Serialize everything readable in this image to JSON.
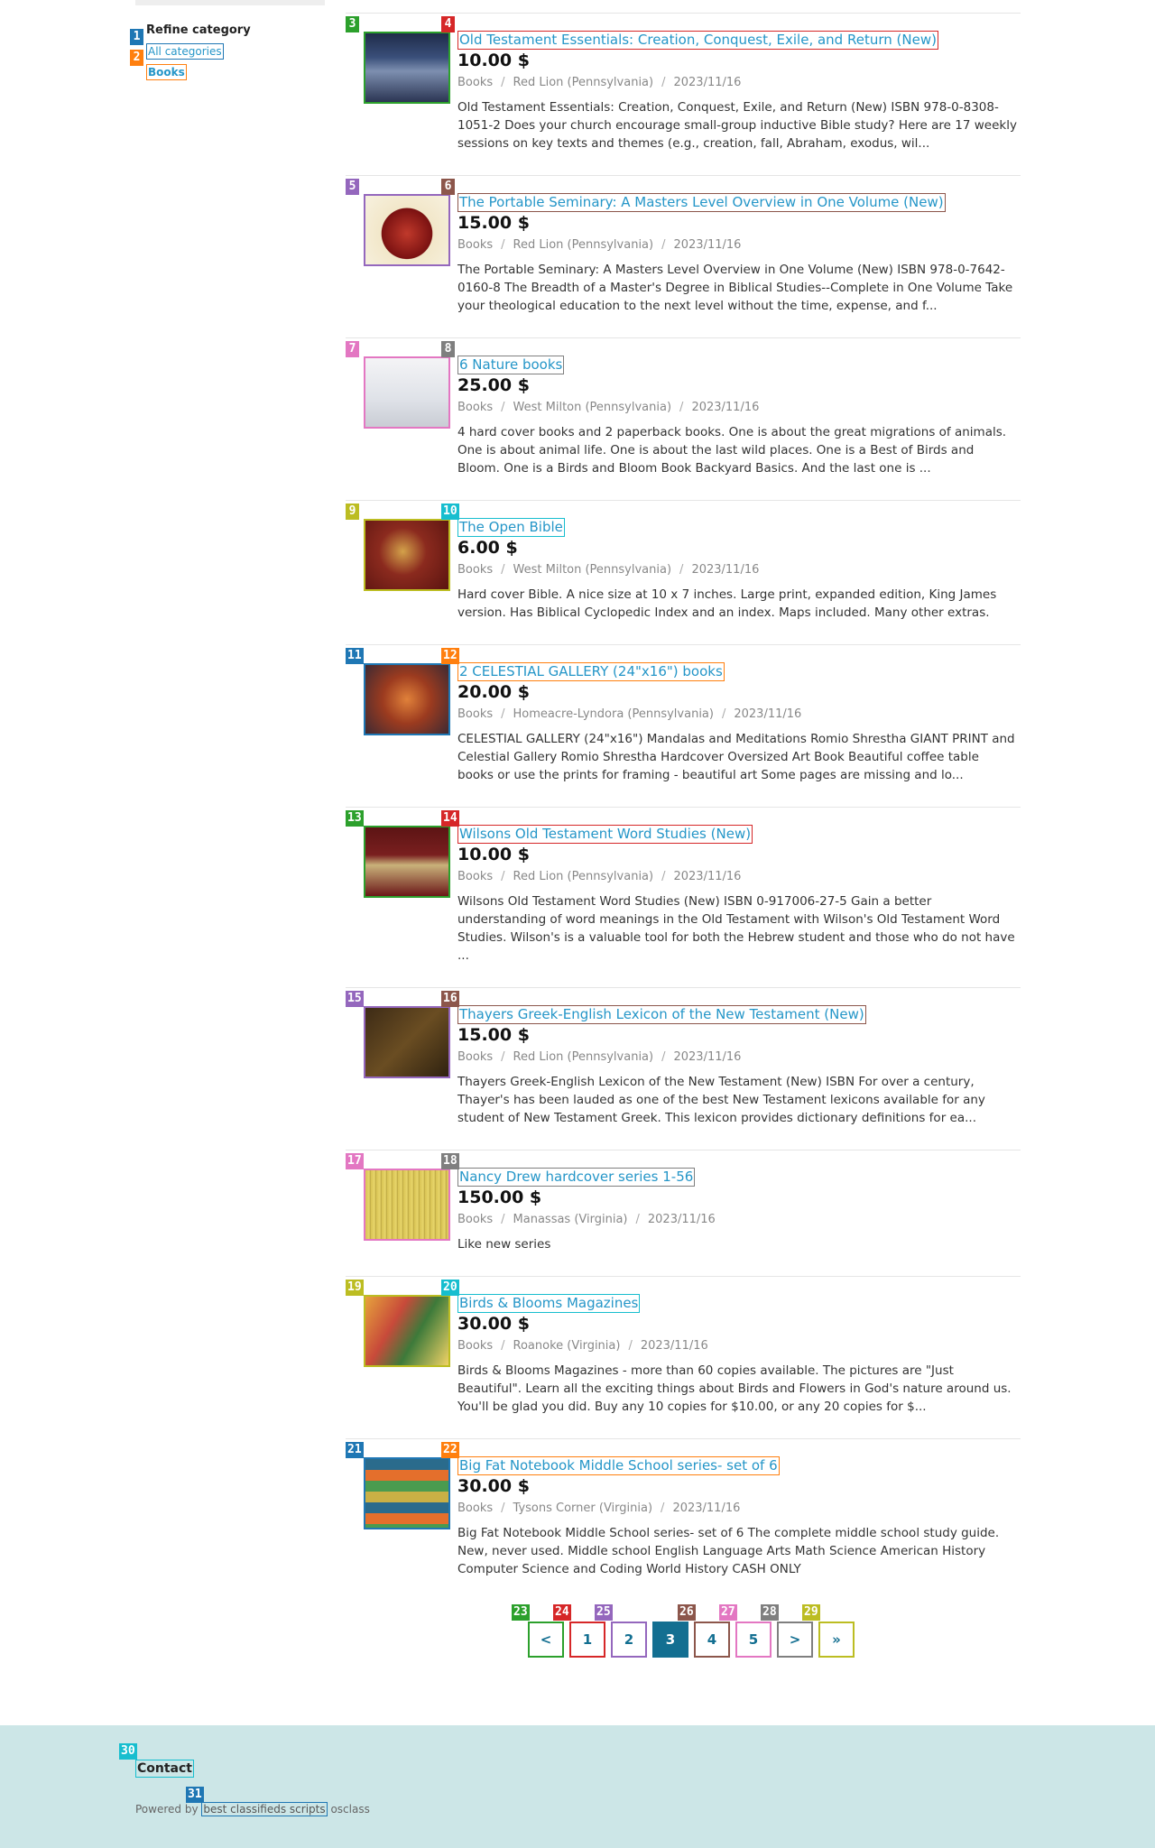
{
  "sidebar": {
    "title": "Refine category",
    "links": [
      {
        "label": "All categories",
        "tag": "1"
      },
      {
        "label": "Books",
        "tag": "2"
      }
    ]
  },
  "colors": {
    "link": "#2596c8",
    "accent": "#136f91",
    "footer_bg": "#cce6e7",
    "tags": [
      "#1f77b4",
      "#ff7f0e",
      "#2ca02c",
      "#d62728",
      "#9467bd",
      "#8c564b",
      "#e377c2",
      "#7f7f7f",
      "#bcbd22",
      "#17becf"
    ]
  },
  "listings": [
    {
      "thumb_tag": "3",
      "title_tag": "4",
      "title": "Old Testament Essentials: Creation, Conquest, Exile, and Return (New)",
      "price": "10.00 $",
      "category": "Books",
      "location": "Red Lion (Pennsylvania)",
      "date": "2023/11/16",
      "description": "Old Testament Essentials: Creation, Conquest, Exile, and Return (New) ISBN 978-0-8308-1051-2 Does your church encourage small-group inductive Bible study? Here are 17 weekly sessions on key texts and themes (e.g., creation, fall, Abraham, exodus, wil...",
      "thumb_icon": "book-cover-dark-blue"
    },
    {
      "thumb_tag": "5",
      "title_tag": "6",
      "title": "The Portable Seminary: A Masters Level Overview in One Volume (New)",
      "price": "15.00 $",
      "category": "Books",
      "location": "Red Lion (Pennsylvania)",
      "date": "2023/11/16",
      "description": "The Portable Seminary: A Masters Level Overview in One Volume (New) ISBN 978-0-7642-0160-8 The Breadth of a Master's Degree in Biblical Studies--Complete in One Volume Take your theological education to the next level without the time, expense, and f...",
      "thumb_icon": "book-cover-red"
    },
    {
      "thumb_tag": "7",
      "title_tag": "8",
      "title": "6 Nature books",
      "price": "25.00 $",
      "category": "Books",
      "location": "West Milton (Pennsylvania)",
      "date": "2023/11/16",
      "description": "4 hard cover books and 2 paperback books. One is about the great migrations of animals. One is about animal life. One is about the last wild places. One is a Best of Birds and Bloom. One is a Birds and Bloom Book Backyard Basics. And the last one is ...",
      "thumb_icon": "book-cover-white"
    },
    {
      "thumb_tag": "9",
      "title_tag": "10",
      "title": "The Open Bible",
      "price": "6.00 $",
      "category": "Books",
      "location": "West Milton (Pennsylvania)",
      "date": "2023/11/16",
      "description": "Hard cover Bible. A nice size at 10 x 7 inches. Large print, expanded edition, King James version. Has Biblical Cyclopedic Index and an index. Maps included. Many other extras.",
      "thumb_icon": "book-cover-maroon"
    },
    {
      "thumb_tag": "11",
      "title_tag": "12",
      "title": "2 CELESTIAL GALLERY (24\"x16\") books",
      "price": "20.00 $",
      "category": "Books",
      "location": "Homeacre-Lyndora (Pennsylvania)",
      "date": "2023/11/16",
      "description": "CELESTIAL GALLERY (24\"x16\") Mandalas and Meditations Romio Shrestha GIANT PRINT and Celestial Gallery Romio Shrestha Hardcover Oversized Art Book Beautiful coffee table books or use the prints for framing - beautiful art Some pages are missing and lo...",
      "thumb_icon": "book-cover-orange"
    },
    {
      "thumb_tag": "13",
      "title_tag": "14",
      "title": "Wilsons Old Testament Word Studies (New)",
      "price": "10.00 $",
      "category": "Books",
      "location": "Red Lion (Pennsylvania)",
      "date": "2023/11/16",
      "description": "Wilsons Old Testament Word Studies (New) ISBN 0-917006-27-5 Gain a better understanding of word meanings in the Old Testament with Wilson's Old Testament Word Studies. Wilson's is a valuable tool for both the Hebrew student and those who do not have ...",
      "thumb_icon": "book-cover-darkred"
    },
    {
      "thumb_tag": "15",
      "title_tag": "16",
      "title": "Thayers Greek-English Lexicon of the New Testament (New)",
      "price": "15.00 $",
      "category": "Books",
      "location": "Red Lion (Pennsylvania)",
      "date": "2023/11/16",
      "description": "Thayers Greek-English Lexicon of the New Testament (New) ISBN For over a century, Thayer's has been lauded as one of the best New Testament lexicons available for any student of New Testament Greek. This lexicon provides dictionary definitions for ea...",
      "thumb_icon": "book-cover-brown"
    },
    {
      "thumb_tag": "17",
      "title_tag": "18",
      "title": "Nancy Drew hardcover series 1-56",
      "price": "150.00 $",
      "category": "Books",
      "location": "Manassas (Virginia)",
      "date": "2023/11/16",
      "description": "Like new series",
      "thumb_icon": "book-spines-yellow"
    },
    {
      "thumb_tag": "19",
      "title_tag": "20",
      "title": "Birds & Blooms Magazines",
      "price": "30.00 $",
      "category": "Books",
      "location": "Roanoke (Virginia)",
      "date": "2023/11/16",
      "description": "Birds & Blooms Magazines - more than 60 copies available. The pictures are \"Just Beautiful\". Learn all the exciting things about Birds and Flowers in God's nature around us. You'll be glad you did. Buy any 10 copies for $10.00, or any 20 copies for $...",
      "thumb_icon": "magazines"
    },
    {
      "thumb_tag": "21",
      "title_tag": "22",
      "title": "Big Fat Notebook Middle School series- set of 6",
      "price": "30.00 $",
      "category": "Books",
      "location": "Tysons Corner (Virginia)",
      "date": "2023/11/16",
      "description": "Big Fat Notebook Middle School series- set of 6 The complete middle school study guide. New, never used. Middle school English Language Arts Math Science American History Computer Science and Coding World History CASH ONLY",
      "thumb_icon": "book-stack"
    }
  ],
  "pagination": {
    "items": [
      {
        "label": "<",
        "tag": "23"
      },
      {
        "label": "1",
        "tag": "24"
      },
      {
        "label": "2",
        "tag": "25"
      },
      {
        "label": "3",
        "tag": "",
        "active": true
      },
      {
        "label": "4",
        "tag": "26"
      },
      {
        "label": "5",
        "tag": "27"
      },
      {
        "label": ">",
        "tag": "28"
      },
      {
        "label": "»",
        "tag": "29"
      }
    ]
  },
  "footer": {
    "contact": "Contact",
    "contact_tag": "30",
    "powered_prefix": "Powered by",
    "powered_link": "best classifieds scripts",
    "powered_link_tag": "31",
    "powered_suffix": "osclass"
  }
}
